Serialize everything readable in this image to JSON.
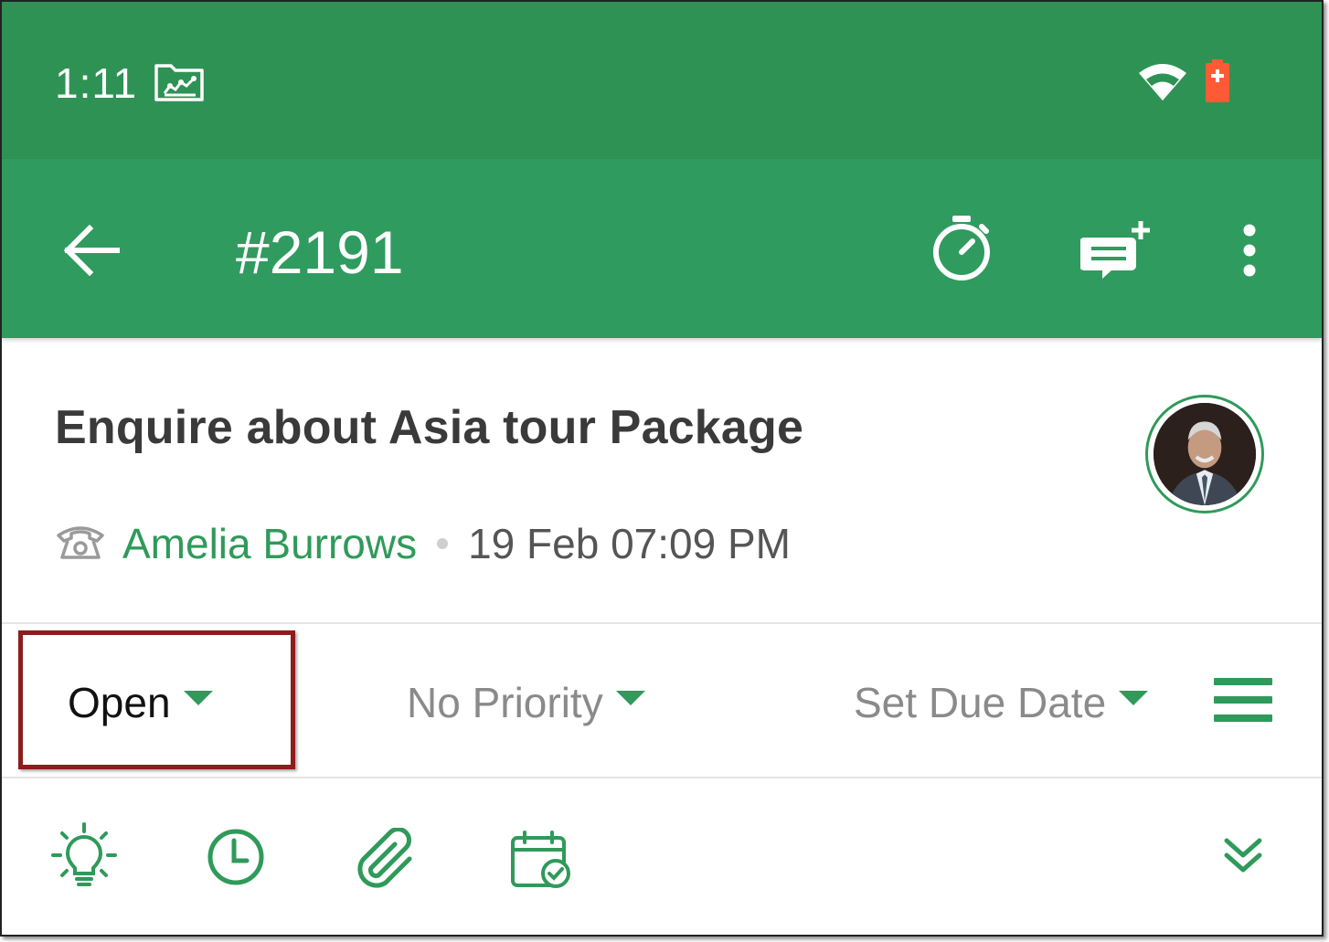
{
  "status_bar": {
    "time": "1:11",
    "icons": [
      "workspace-folder-icon",
      "wifi-icon",
      "battery-low-icon"
    ]
  },
  "toolbar": {
    "back_icon": "arrow-left-icon",
    "ticket_id": "#2191",
    "actions": [
      "stopwatch-icon",
      "add-note-icon",
      "more-vertical-icon"
    ]
  },
  "ticket": {
    "subject": "Enquire about Asia tour Package",
    "channel_icon": "phone-icon",
    "requester": "Amelia Burrows",
    "created": "19 Feb 07:09 PM"
  },
  "properties": {
    "status": "Open",
    "priority": "No Priority",
    "due_date": "Set Due Date",
    "menu_icon": "hamburger-menu-icon"
  },
  "bottom_actions": [
    "lightbulb-icon",
    "clock-icon",
    "paperclip-icon",
    "calendar-check-icon",
    "expand-down-icon"
  ],
  "colors": {
    "status_bar": "#2f9255",
    "toolbar": "#309b5e",
    "accent": "#2f9a5a",
    "highlight": "#8f1c1c"
  }
}
